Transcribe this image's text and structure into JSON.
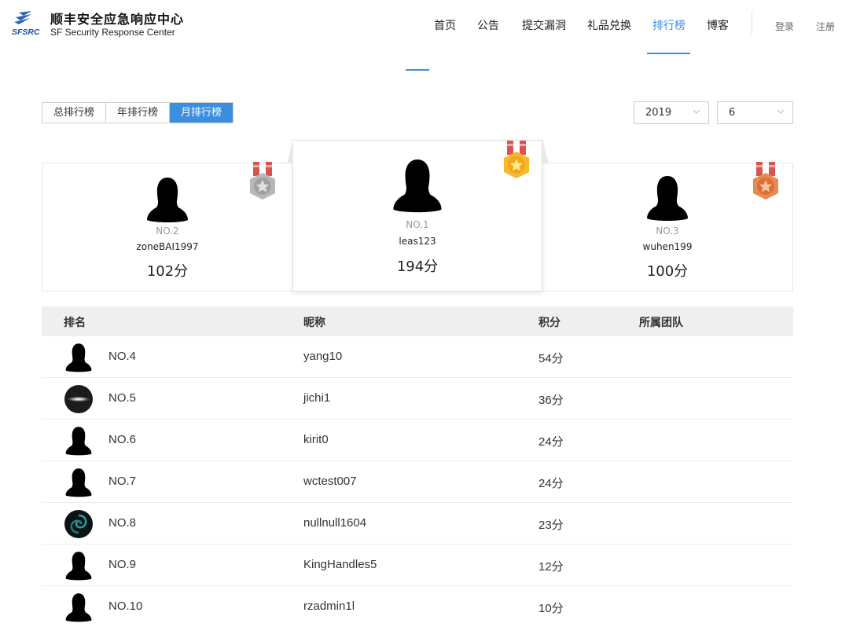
{
  "brand": {
    "logo_text": "SFSRC",
    "title": "顺丰安全应急响应中心",
    "subtitle": "SF Security Response Center"
  },
  "nav": {
    "items": [
      {
        "label": "首页"
      },
      {
        "label": "公告"
      },
      {
        "label": "提交漏洞"
      },
      {
        "label": "礼品兑换"
      },
      {
        "label": "排行榜"
      },
      {
        "label": "博客"
      }
    ],
    "active": "排行榜",
    "login": "登录",
    "register": "注册"
  },
  "tabs": [
    {
      "label": "总排行榜"
    },
    {
      "label": "年排行榜"
    },
    {
      "label": "月排行榜"
    }
  ],
  "active_tab": "月排行榜",
  "filters": {
    "year": "2019",
    "month": "6"
  },
  "podium": {
    "first": {
      "rank": "NO.1",
      "name": "leas123",
      "score": "194分",
      "medal": "gold"
    },
    "second": {
      "rank": "NO.2",
      "name": "zoneBAI1997",
      "score": "102分",
      "medal": "silver"
    },
    "third": {
      "rank": "NO.3",
      "name": "wuhen199",
      "score": "100分",
      "medal": "bronze"
    }
  },
  "table": {
    "headers": {
      "rank": "排名",
      "name": "昵称",
      "score": "积分",
      "team": "所属团队"
    },
    "rows": [
      {
        "rank": "NO.4",
        "name": "yang10",
        "score": "54分",
        "team": "",
        "avatar": "silhouette"
      },
      {
        "rank": "NO.5",
        "name": "jichi1",
        "score": "36分",
        "team": "",
        "avatar": "galaxy"
      },
      {
        "rank": "NO.6",
        "name": "kirit0",
        "score": "24分",
        "team": "",
        "avatar": "silhouette"
      },
      {
        "rank": "NO.7",
        "name": "wctest007",
        "score": "24分",
        "team": "",
        "avatar": "silhouette"
      },
      {
        "rank": "NO.8",
        "name": "nullnull1604",
        "score": "23分",
        "team": "",
        "avatar": "swirl"
      },
      {
        "rank": "NO.9",
        "name": "KingHandles5",
        "score": "12分",
        "team": "",
        "avatar": "silhouette"
      },
      {
        "rank": "NO.10",
        "name": "rzadmin1l",
        "score": "10分",
        "team": "",
        "avatar": "silhouette"
      }
    ]
  },
  "colors": {
    "accent": "#3b8ee0",
    "gold": "#f5b82e",
    "silver": "#b8b8b8",
    "bronze": "#e88a52",
    "ribbon": "#d9534f"
  }
}
